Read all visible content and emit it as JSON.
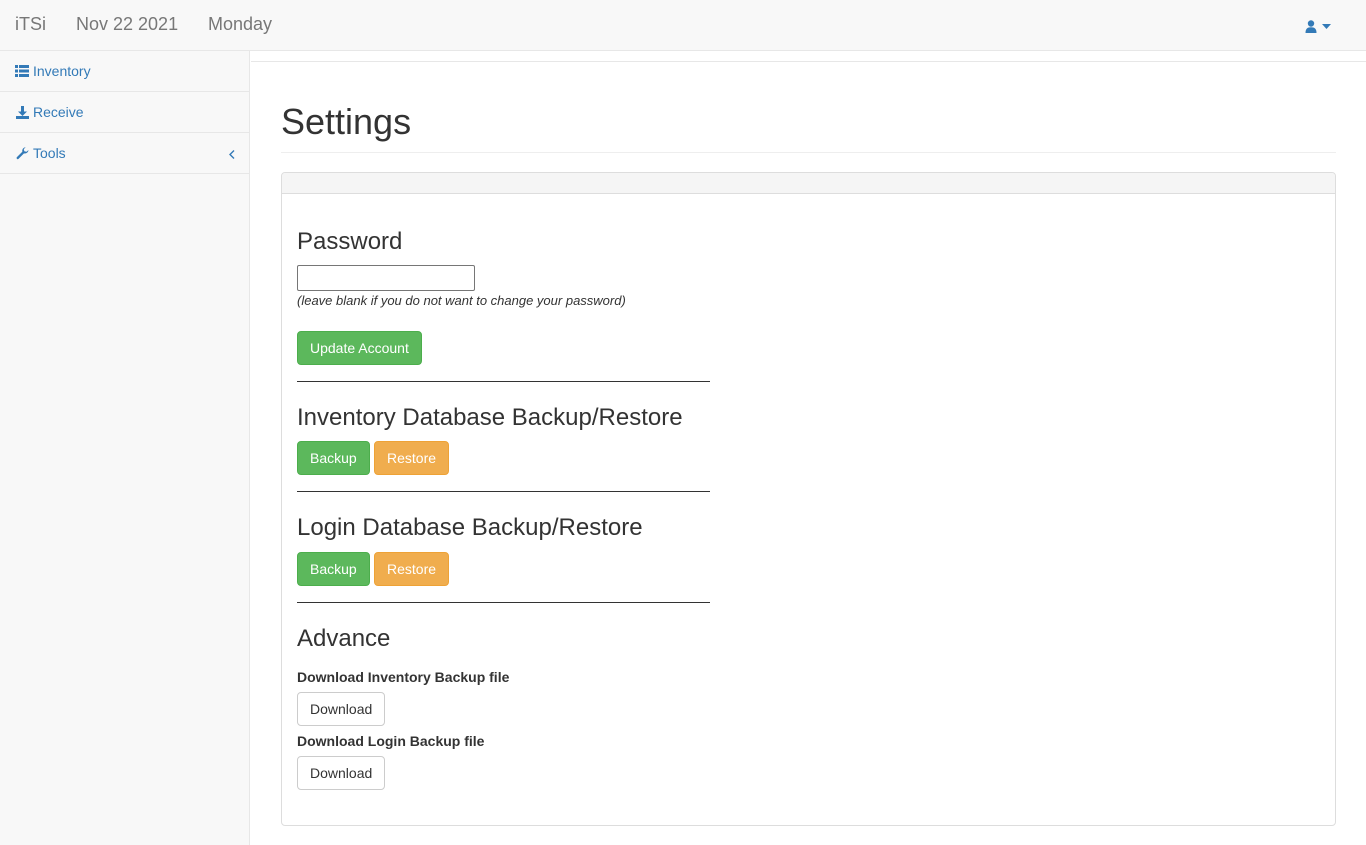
{
  "navbar": {
    "brand": "iTSi",
    "date": "Nov 22 2021",
    "day": "Monday",
    "user_icon": "user-icon",
    "caret_icon": "caret-down-icon"
  },
  "sidebar": {
    "items": [
      {
        "label": "Inventory",
        "icon": "list-icon"
      },
      {
        "label": "Receive",
        "icon": "download-icon"
      },
      {
        "label": "Tools",
        "icon": "wrench-icon",
        "expand_icon": "chevron-left-icon"
      }
    ]
  },
  "page": {
    "title": "Settings"
  },
  "password": {
    "heading": "Password",
    "value": "",
    "help": "(leave blank if you do not want to change your password)",
    "update_button": "Update Account"
  },
  "inventory_db": {
    "heading": "Inventory Database Backup/Restore",
    "backup_button": "Backup",
    "restore_button": "Restore"
  },
  "login_db": {
    "heading": "Login Database Backup/Restore",
    "backup_button": "Backup",
    "restore_button": "Restore"
  },
  "advance": {
    "heading": "Advance",
    "inventory_label": "Download Inventory Backup file",
    "inventory_button": "Download",
    "login_label": "Download Login Backup file",
    "login_button": "Download"
  },
  "colors": {
    "link": "#337ab7",
    "success": "#5cb85c",
    "warning": "#f0ad4e"
  }
}
